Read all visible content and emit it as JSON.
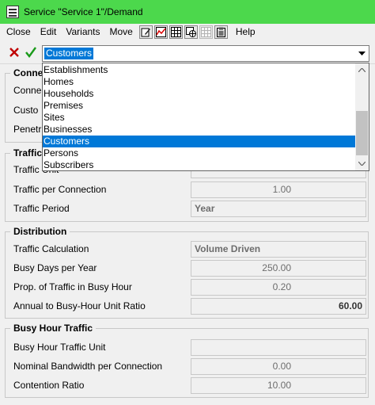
{
  "window": {
    "title": "Service \"Service 1\"/Demand"
  },
  "menu": {
    "items": [
      "Close",
      "Edit",
      "Variants",
      "Move"
    ],
    "help": "Help"
  },
  "toolbar": {
    "icons": [
      "edit-icon",
      "chart-icon",
      "grid-icon",
      "globe-icon",
      "grid-disabled-icon",
      "clipboard-icon"
    ]
  },
  "combo": {
    "value": "Customers"
  },
  "dropdown": {
    "options": [
      "Establishments",
      "Homes",
      "Households",
      "Premises",
      "Sites",
      "Businesses",
      "Customers",
      "Persons",
      "Subscribers"
    ],
    "selected_index": 6
  },
  "groups": {
    "connections": {
      "title": "Conne",
      "rows": [
        "Conne",
        "Custo",
        "Penetr"
      ]
    },
    "traffic": {
      "title": "Traffic",
      "rows": [
        {
          "label": "Traffic Unit",
          "value": ""
        },
        {
          "label": "Traffic per Connection",
          "value": "1.00"
        },
        {
          "label": "Traffic Period",
          "value": "Year"
        }
      ]
    },
    "distribution": {
      "title": "Distribution",
      "rows": [
        {
          "label": "Traffic Calculation",
          "value": "Volume Driven"
        },
        {
          "label": "Busy Days per Year",
          "value": "250.00"
        },
        {
          "label": "Prop. of Traffic in Busy Hour",
          "value": "0.20"
        },
        {
          "label": "Annual to Busy-Hour Unit Ratio",
          "value": "60.00"
        }
      ]
    },
    "busy_hour": {
      "title": "Busy Hour Traffic",
      "rows": [
        {
          "label": "Busy Hour Traffic Unit",
          "value": ""
        },
        {
          "label": "Nominal Bandwidth per Connection",
          "value": "0.00"
        },
        {
          "label": "Contention Ratio",
          "value": "10.00"
        }
      ]
    }
  },
  "colors": {
    "titlebar": "#4cd84c",
    "selection": "#0078d7"
  }
}
